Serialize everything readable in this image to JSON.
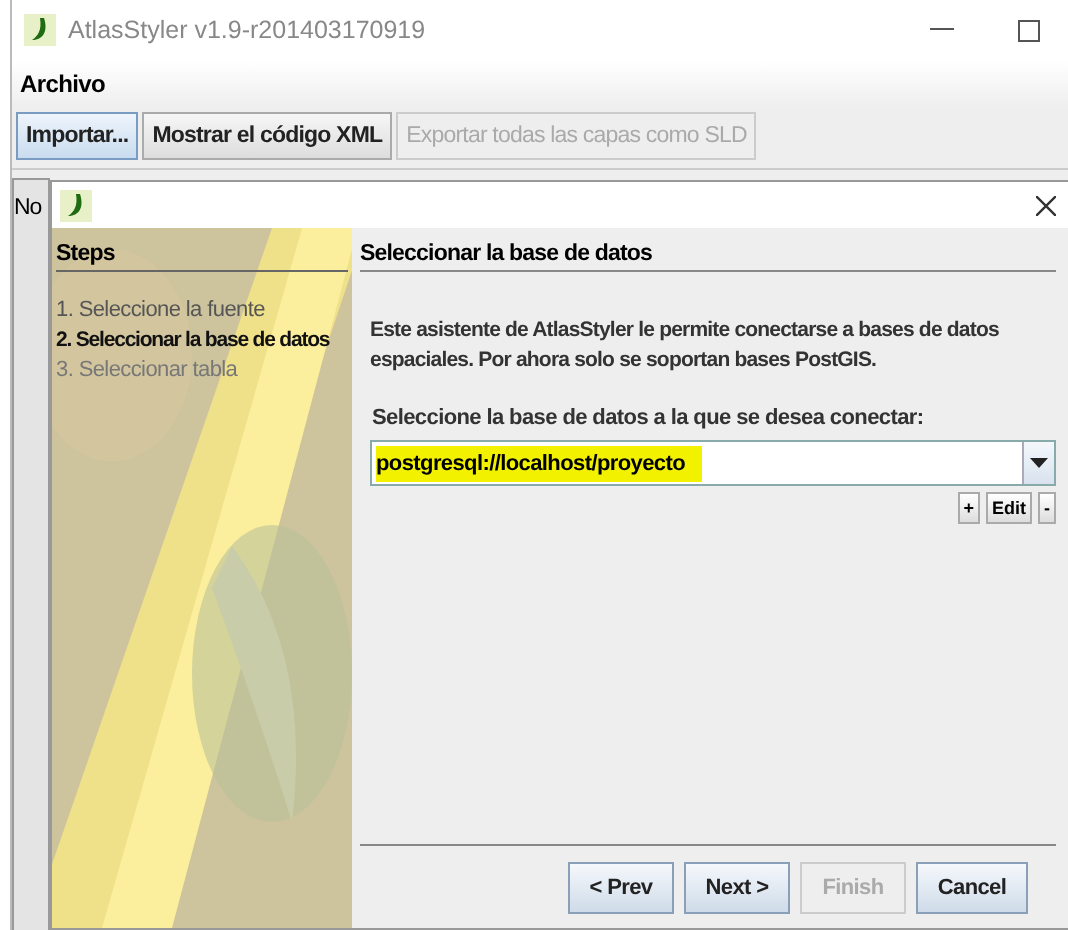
{
  "window": {
    "title": "AtlasStyler v1.9-r201403170919"
  },
  "menu": [
    {
      "label": "Archivo"
    }
  ],
  "toolbar": [
    {
      "label": "Importar...",
      "focused": true,
      "disabled": false
    },
    {
      "label": "Mostrar el código XML",
      "focused": false,
      "disabled": false
    },
    {
      "label": "Exportar todas las capas como SLD",
      "focused": false,
      "disabled": true
    }
  ],
  "background_text": "No",
  "dialog": {
    "steps_title": "Steps",
    "steps": [
      {
        "label": "1. Seleccione la fuente",
        "selected": false,
        "done": true
      },
      {
        "label": "2. Seleccionar la base de datos",
        "selected": true,
        "done": false
      },
      {
        "label": "3. Seleccionar tabla",
        "selected": false,
        "done": false
      }
    ],
    "page_title": "Seleccionar la base de datos",
    "description": "Este asistente de AtlasStyler le permite conectarse a bases de datos espaciales. Por ahora solo se soportan bases PostGIS.",
    "field_label": "Seleccione la base de datos a la que se desea conectar:",
    "database": {
      "value": "postgresql://localhost/proyecto",
      "highlighted": true
    },
    "small_buttons": [
      "+",
      "Edit",
      "-"
    ],
    "buttons": [
      {
        "label": "< Prev",
        "disabled": false
      },
      {
        "label": "Next >",
        "disabled": false
      },
      {
        "label": "Finish",
        "disabled": true
      },
      {
        "label": "Cancel",
        "disabled": false
      }
    ]
  }
}
